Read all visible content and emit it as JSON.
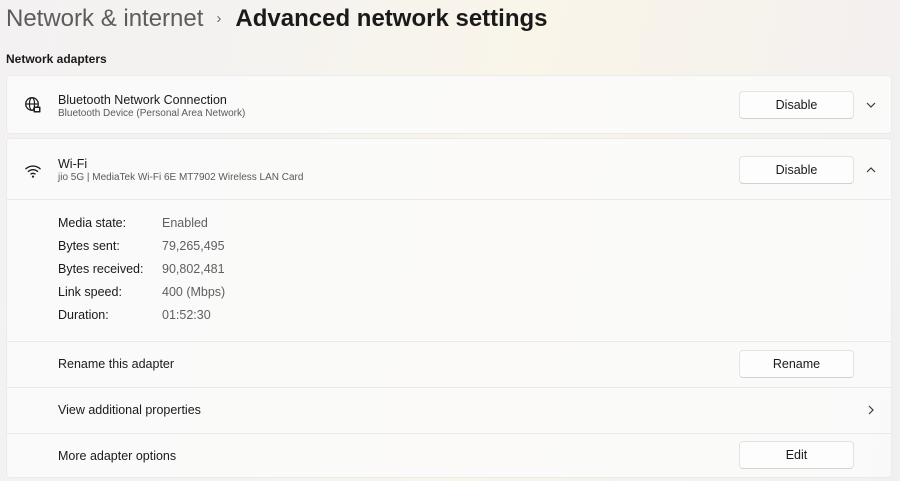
{
  "breadcrumb": {
    "parent": "Network & internet",
    "separator": "›",
    "current": "Advanced network settings"
  },
  "section_heading": "Network adapters",
  "adapters": [
    {
      "name": "Bluetooth Network Connection",
      "description": "Bluetooth Device (Personal Area Network)",
      "icon": "globe-network-icon",
      "button_label": "Disable",
      "expanded": false,
      "chevron_icon": "chevron-down-icon"
    },
    {
      "name": "Wi-Fi",
      "description": "jio 5G | MediaTek Wi-Fi 6E MT7902 Wireless LAN Card",
      "icon": "wifi-icon",
      "button_label": "Disable",
      "expanded": true,
      "chevron_icon": "chevron-up-icon",
      "details": [
        {
          "label": "Media state:",
          "value": "Enabled"
        },
        {
          "label": "Bytes sent:",
          "value": "79,265,495"
        },
        {
          "label": "Bytes received:",
          "value": "90,802,481"
        },
        {
          "label": "Link speed:",
          "value": "400 (Mbps)"
        },
        {
          "label": "Duration:",
          "value": "01:52:30"
        }
      ],
      "actions": {
        "rename": {
          "label": "Rename this adapter",
          "button_label": "Rename"
        },
        "properties": {
          "label": "View additional properties",
          "icon": "chevron-right-icon"
        },
        "more_options": {
          "label": "More adapter options",
          "button_label": "Edit"
        }
      }
    }
  ]
}
